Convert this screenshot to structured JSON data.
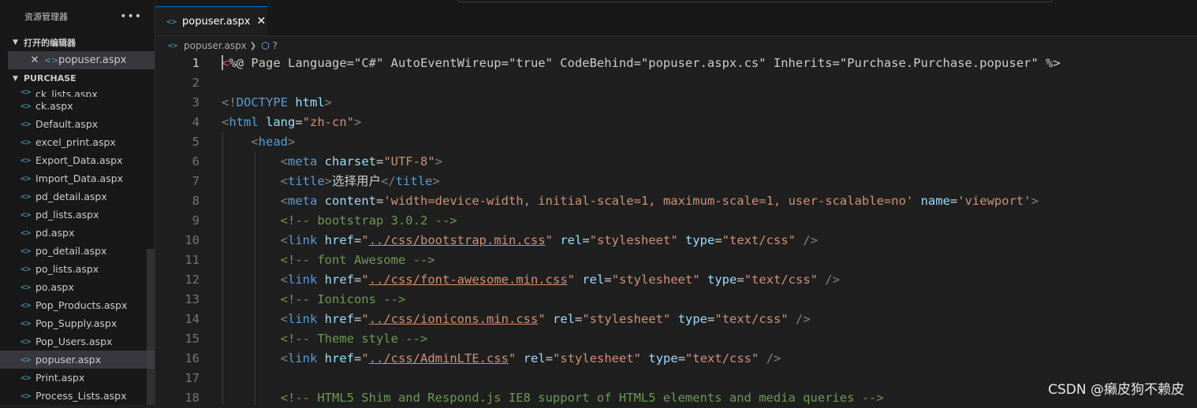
{
  "sidebar": {
    "title": "资源管理器",
    "more_icon": "•••",
    "open_editors": {
      "label": "打开的编辑器",
      "items": [
        {
          "name": "popuser.aspx"
        }
      ]
    },
    "project": {
      "label": "PURCHASE",
      "files": [
        "ck_lists.aspx",
        "ck.aspx",
        "Default.aspx",
        "excel_print.aspx",
        "Export_Data.aspx",
        "Import_Data.aspx",
        "pd_detail.aspx",
        "pd_lists.aspx",
        "pd.aspx",
        "po_detail.aspx",
        "po_lists.aspx",
        "po.aspx",
        "Pop_Products.aspx",
        "Pop_Supply.aspx",
        "Pop_Users.aspx",
        "popuser.aspx",
        "Print.aspx",
        "Process_Lists.aspx"
      ],
      "selected": "popuser.aspx"
    }
  },
  "tabs": [
    {
      "label": "popuser.aspx",
      "active": true
    }
  ],
  "breadcrumb": {
    "file": "popuser.aspx",
    "symbol": "?"
  },
  "editor": {
    "current_line": 1,
    "lines": [
      {
        "n": "1",
        "tokens": [
          [
            "aspx",
            "<"
          ],
          [
            "txt",
            "%@ Page Language=\"C#\" AutoEventWireup=\"true\" CodeBehind=\"popuser.aspx.cs\" Inherits=\"Purchase.Purchase.popuser\" %>"
          ]
        ]
      },
      {
        "n": "2",
        "tokens": []
      },
      {
        "n": "3",
        "tokens": [
          [
            "delim",
            "<!"
          ],
          [
            "tag",
            "DOCTYPE"
          ],
          [
            "txt",
            " "
          ],
          [
            "attr",
            "html"
          ],
          [
            "delim",
            ">"
          ]
        ]
      },
      {
        "n": "4",
        "tokens": [
          [
            "delim",
            "<"
          ],
          [
            "tag",
            "html"
          ],
          [
            "txt",
            " "
          ],
          [
            "attr",
            "lang"
          ],
          [
            "txt",
            "="
          ],
          [
            "str",
            "\"zh-cn\""
          ],
          [
            "delim",
            ">"
          ]
        ]
      },
      {
        "n": "5",
        "tokens": [
          [
            "txt",
            "    "
          ],
          [
            "delim",
            "<"
          ],
          [
            "tag",
            "head"
          ],
          [
            "delim",
            ">"
          ]
        ]
      },
      {
        "n": "6",
        "tokens": [
          [
            "txt",
            "        "
          ],
          [
            "delim",
            "<"
          ],
          [
            "tag",
            "meta"
          ],
          [
            "txt",
            " "
          ],
          [
            "attr",
            "charset"
          ],
          [
            "txt",
            "="
          ],
          [
            "str",
            "\"UTF-8\""
          ],
          [
            "delim",
            ">"
          ]
        ]
      },
      {
        "n": "7",
        "tokens": [
          [
            "txt",
            "        "
          ],
          [
            "delim",
            "<"
          ],
          [
            "tag",
            "title"
          ],
          [
            "delim",
            ">"
          ],
          [
            "txt",
            "选择用户"
          ],
          [
            "delim",
            "</"
          ],
          [
            "tag",
            "title"
          ],
          [
            "delim",
            ">"
          ]
        ]
      },
      {
        "n": "8",
        "tokens": [
          [
            "txt",
            "        "
          ],
          [
            "delim",
            "<"
          ],
          [
            "tag",
            "meta"
          ],
          [
            "txt",
            " "
          ],
          [
            "attr",
            "content"
          ],
          [
            "txt",
            "="
          ],
          [
            "str",
            "'width=device-width, initial-scale=1, maximum-scale=1, user-scalable=no'"
          ],
          [
            "txt",
            " "
          ],
          [
            "attr",
            "name"
          ],
          [
            "txt",
            "="
          ],
          [
            "str",
            "'viewport'"
          ],
          [
            "delim",
            ">"
          ]
        ]
      },
      {
        "n": "9",
        "tokens": [
          [
            "txt",
            "        "
          ],
          [
            "com",
            "<!-- bootstrap 3.0.2 -->"
          ]
        ]
      },
      {
        "n": "10",
        "tokens": [
          [
            "txt",
            "        "
          ],
          [
            "delim",
            "<"
          ],
          [
            "tag",
            "link"
          ],
          [
            "txt",
            " "
          ],
          [
            "attr",
            "href"
          ],
          [
            "txt",
            "="
          ],
          [
            "str",
            "\""
          ],
          [
            "link",
            "../css/bootstrap.min.css"
          ],
          [
            "str",
            "\""
          ],
          [
            "txt",
            " "
          ],
          [
            "attr",
            "rel"
          ],
          [
            "txt",
            "="
          ],
          [
            "str",
            "\"stylesheet\""
          ],
          [
            "txt",
            " "
          ],
          [
            "attr",
            "type"
          ],
          [
            "txt",
            "="
          ],
          [
            "str",
            "\"text/css\""
          ],
          [
            "txt",
            " "
          ],
          [
            "delim",
            "/>"
          ]
        ]
      },
      {
        "n": "11",
        "tokens": [
          [
            "txt",
            "        "
          ],
          [
            "com",
            "<!-- font Awesome -->"
          ]
        ]
      },
      {
        "n": "12",
        "tokens": [
          [
            "txt",
            "        "
          ],
          [
            "delim",
            "<"
          ],
          [
            "tag",
            "link"
          ],
          [
            "txt",
            " "
          ],
          [
            "attr",
            "href"
          ],
          [
            "txt",
            "="
          ],
          [
            "str",
            "\""
          ],
          [
            "link",
            "../css/font-awesome.min.css"
          ],
          [
            "str",
            "\""
          ],
          [
            "txt",
            " "
          ],
          [
            "attr",
            "rel"
          ],
          [
            "txt",
            "="
          ],
          [
            "str",
            "\"stylesheet\""
          ],
          [
            "txt",
            " "
          ],
          [
            "attr",
            "type"
          ],
          [
            "txt",
            "="
          ],
          [
            "str",
            "\"text/css\""
          ],
          [
            "txt",
            " "
          ],
          [
            "delim",
            "/>"
          ]
        ]
      },
      {
        "n": "13",
        "tokens": [
          [
            "txt",
            "        "
          ],
          [
            "com",
            "<!-- Ionicons -->"
          ]
        ]
      },
      {
        "n": "14",
        "tokens": [
          [
            "txt",
            "        "
          ],
          [
            "delim",
            "<"
          ],
          [
            "tag",
            "link"
          ],
          [
            "txt",
            " "
          ],
          [
            "attr",
            "href"
          ],
          [
            "txt",
            "="
          ],
          [
            "str",
            "\""
          ],
          [
            "link",
            "../css/ionicons.min.css"
          ],
          [
            "str",
            "\""
          ],
          [
            "txt",
            " "
          ],
          [
            "attr",
            "rel"
          ],
          [
            "txt",
            "="
          ],
          [
            "str",
            "\"stylesheet\""
          ],
          [
            "txt",
            " "
          ],
          [
            "attr",
            "type"
          ],
          [
            "txt",
            "="
          ],
          [
            "str",
            "\"text/css\""
          ],
          [
            "txt",
            " "
          ],
          [
            "delim",
            "/>"
          ]
        ]
      },
      {
        "n": "15",
        "tokens": [
          [
            "txt",
            "        "
          ],
          [
            "com",
            "<!-- Theme style -->"
          ]
        ]
      },
      {
        "n": "16",
        "tokens": [
          [
            "txt",
            "        "
          ],
          [
            "delim",
            "<"
          ],
          [
            "tag",
            "link"
          ],
          [
            "txt",
            " "
          ],
          [
            "attr",
            "href"
          ],
          [
            "txt",
            "="
          ],
          [
            "str",
            "\""
          ],
          [
            "link",
            "../css/AdminLTE.css"
          ],
          [
            "str",
            "\""
          ],
          [
            "txt",
            " "
          ],
          [
            "attr",
            "rel"
          ],
          [
            "txt",
            "="
          ],
          [
            "str",
            "\"stylesheet\""
          ],
          [
            "txt",
            " "
          ],
          [
            "attr",
            "type"
          ],
          [
            "txt",
            "="
          ],
          [
            "str",
            "\"text/css\""
          ],
          [
            "txt",
            " "
          ],
          [
            "delim",
            "/>"
          ]
        ]
      },
      {
        "n": "17",
        "tokens": []
      },
      {
        "n": "18",
        "tokens": [
          [
            "txt",
            "        "
          ],
          [
            "com",
            "<!-- HTML5 Shim and Respond.js IE8 support of HTML5 elements and media queries -->"
          ]
        ]
      }
    ]
  },
  "watermark": "CSDN @癞皮狗不赖皮",
  "colors": {
    "background": "#1f1f1f",
    "sidebar": "#181818",
    "selection": "#37373d",
    "accent": "#0078d4",
    "tag": "#569cd6",
    "attribute": "#9cdcfe",
    "string": "#ce9178",
    "comment": "#6a9955"
  }
}
